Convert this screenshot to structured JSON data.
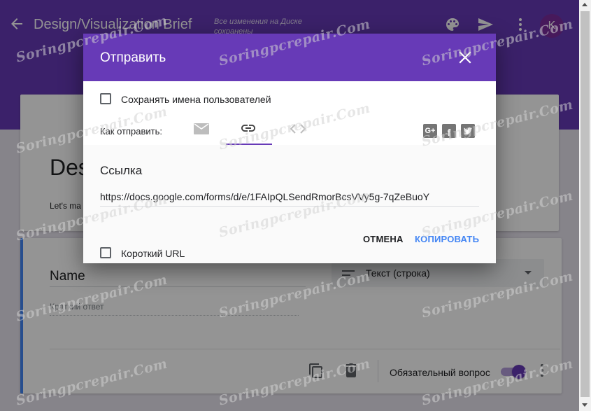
{
  "app": {
    "title": "Design/Visualization Brief",
    "save_status": "Все изменения на Диске сохранены",
    "avatar_letter": "K",
    "icons": [
      "back-arrow-icon",
      "palette-icon",
      "send-icon",
      "more-vert-icon"
    ]
  },
  "form": {
    "title": "Des",
    "description": "Let's ma"
  },
  "question": {
    "title": "Name",
    "answer_placeholder": "Краткий ответ",
    "type": "Текст (строка)",
    "required_label": "Обязательный вопрос",
    "required_on": true
  },
  "dialog": {
    "title": "Отправить",
    "save_names_label": "Сохранять имена пользователей",
    "send_via_label": "Как отправить:",
    "active_method": "link",
    "link_heading": "Ссылка",
    "url": "https://docs.google.com/forms/d/e/1FAIpQLSendRmorBcsVVy5g-7qZeBuoY",
    "short_url_label": "Короткий URL",
    "cancel_label": "ОТМЕНА",
    "copy_label": "КОПИРОВАТЬ",
    "share_icons": [
      "google-plus-icon",
      "facebook-icon",
      "twitter-icon"
    ]
  },
  "watermark": "Soringpcrepair.Com",
  "colors": {
    "accent": "#673ab7",
    "link_button": "#4285f4",
    "question_border": "#4285f4"
  }
}
